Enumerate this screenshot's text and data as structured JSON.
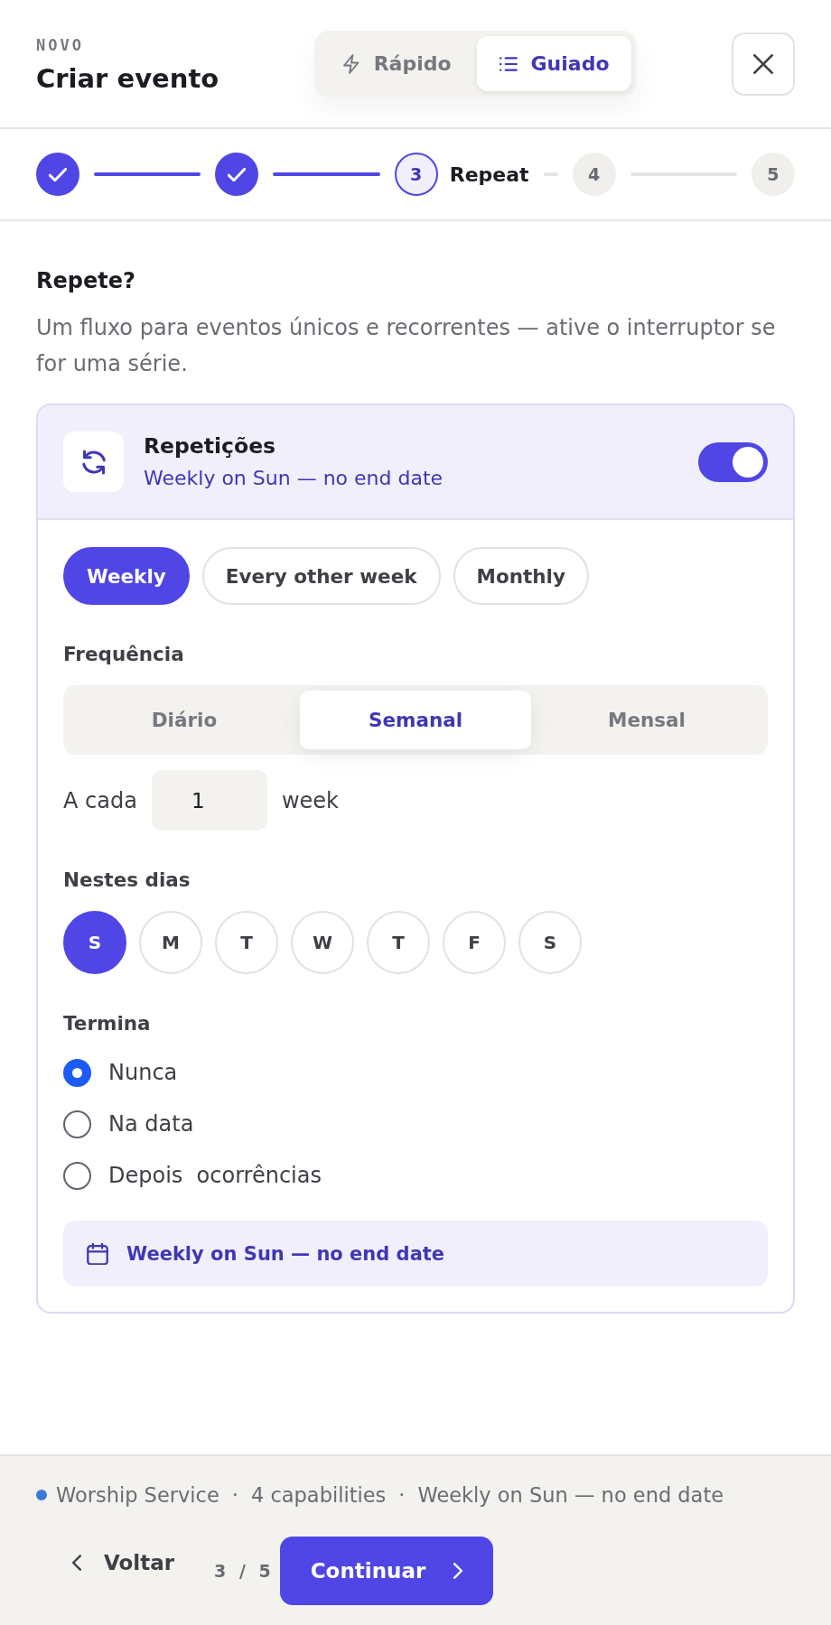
{
  "header": {
    "eyebrow": "NOVO",
    "title": "Criar evento",
    "modes": [
      {
        "kind": "quick",
        "label": "Rápido",
        "selected": false
      },
      {
        "kind": "guided",
        "label": "Guiado",
        "selected": true
      }
    ]
  },
  "stepper": {
    "steps": [
      {
        "done": true,
        "selected": false
      },
      {
        "done": true,
        "selected": false
      },
      {
        "number": "3",
        "label": "Repeat",
        "done": false,
        "selected": true
      },
      {
        "number": "4",
        "done": false,
        "selected": false
      },
      {
        "number": "5",
        "done": false,
        "selected": false
      }
    ]
  },
  "section": {
    "title": "Repete?",
    "description": "Um fluxo para eventos únicos e recorrentes — ative o interruptor se for uma série."
  },
  "repeat": {
    "title": "Repetições",
    "subtitle": "Weekly on Sun — no end date",
    "on": true,
    "presets": [
      {
        "label": "Weekly",
        "selected": true
      },
      {
        "label": "Every other week",
        "selected": false
      },
      {
        "label": "Monthly",
        "selected": false
      }
    ],
    "frequency": {
      "label": "Frequência",
      "options": [
        {
          "label": "Diário",
          "selected": false
        },
        {
          "label": "Semanal",
          "selected": true
        },
        {
          "label": "Mensal",
          "selected": false
        }
      ]
    },
    "interval": {
      "label": "A cada",
      "value": "1",
      "unit": "week"
    },
    "days": {
      "label": "Nestes dias",
      "items": [
        {
          "label": "S",
          "selected": true
        },
        {
          "label": "M",
          "selected": false
        },
        {
          "label": "T",
          "selected": false
        },
        {
          "label": "W",
          "selected": false
        },
        {
          "label": "T",
          "selected": false
        },
        {
          "label": "F",
          "selected": false
        },
        {
          "label": "S",
          "selected": false
        }
      ]
    },
    "ends": {
      "label": "Termina",
      "options": [
        {
          "label": "Nunca",
          "selected": true
        },
        {
          "label": "Na data",
          "selected": false
        },
        {
          "label": "Depois  ocorrências",
          "selected": false
        }
      ]
    },
    "summary": "Weekly on Sun — no end date"
  },
  "footer": {
    "color": "#3a7bd8",
    "parts": [
      {
        "kind": "text",
        "text": "Worship Service"
      },
      {
        "kind": "separator",
        "text": "·"
      },
      {
        "kind": "text",
        "text": "4 capabilities"
      },
      {
        "kind": "separator",
        "text": "·"
      },
      {
        "kind": "text",
        "text": "Weekly on Sun — no end date"
      }
    ],
    "back": "Voltar",
    "counter": "3 / 5",
    "next": "Continuar"
  }
}
